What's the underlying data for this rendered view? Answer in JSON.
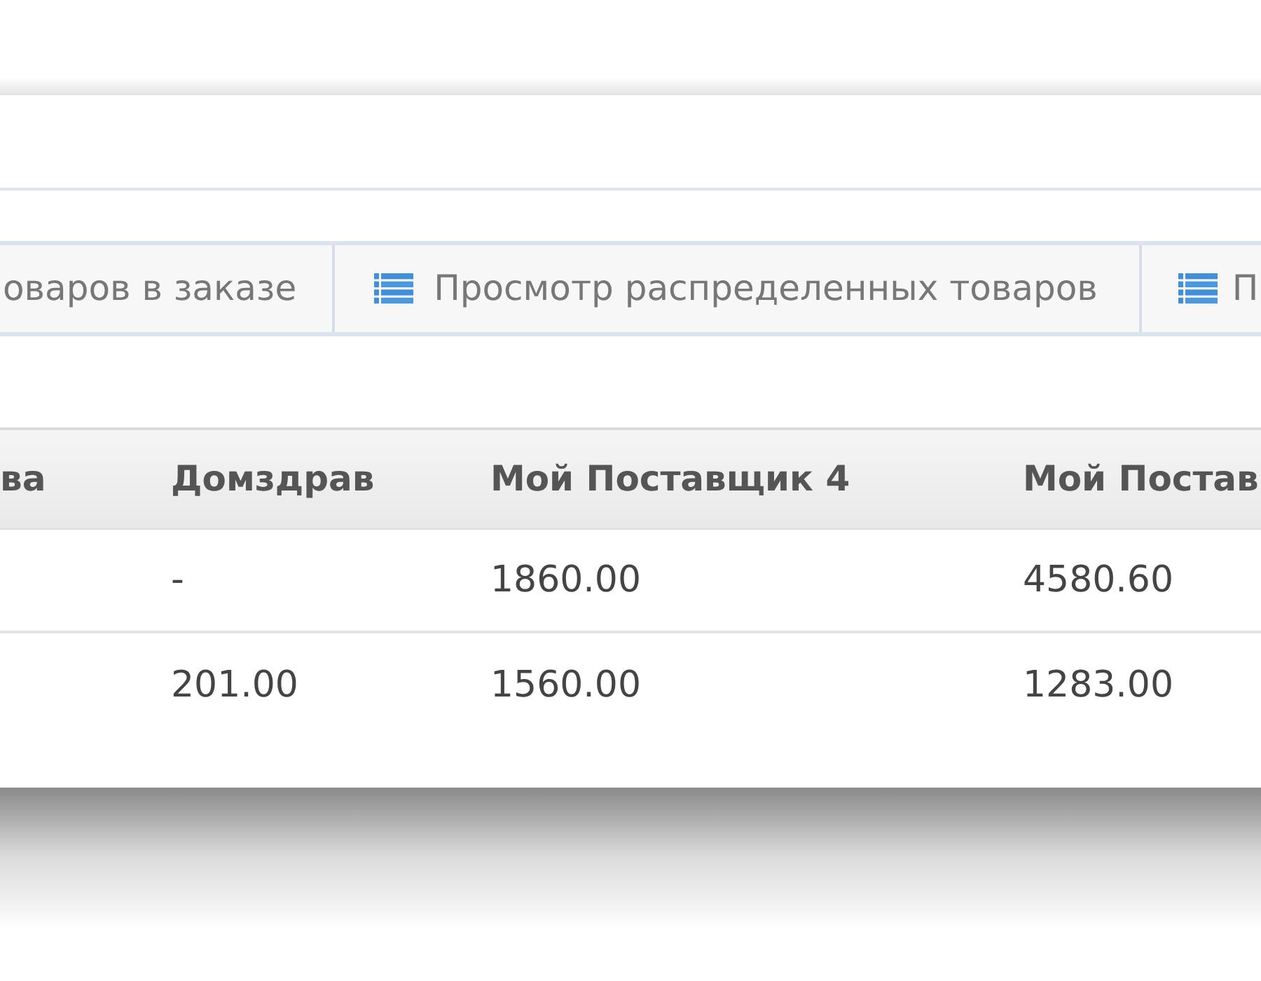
{
  "toolbar": {
    "buttons": [
      {
        "kind": "plain",
        "label": "оваров в заказе"
      },
      {
        "kind": "list",
        "label": "Просмотр распределенных товаров"
      },
      {
        "kind": "list",
        "label": "П"
      }
    ]
  },
  "table": {
    "columns": [
      "ва",
      "Домздрав",
      "Мой Поставщик 4",
      "Мой Постав"
    ],
    "rows": [
      [
        "",
        "-",
        "1860.00",
        "4580.60"
      ],
      [
        "",
        "201.00",
        "1560.00",
        "1283.00"
      ]
    ]
  }
}
